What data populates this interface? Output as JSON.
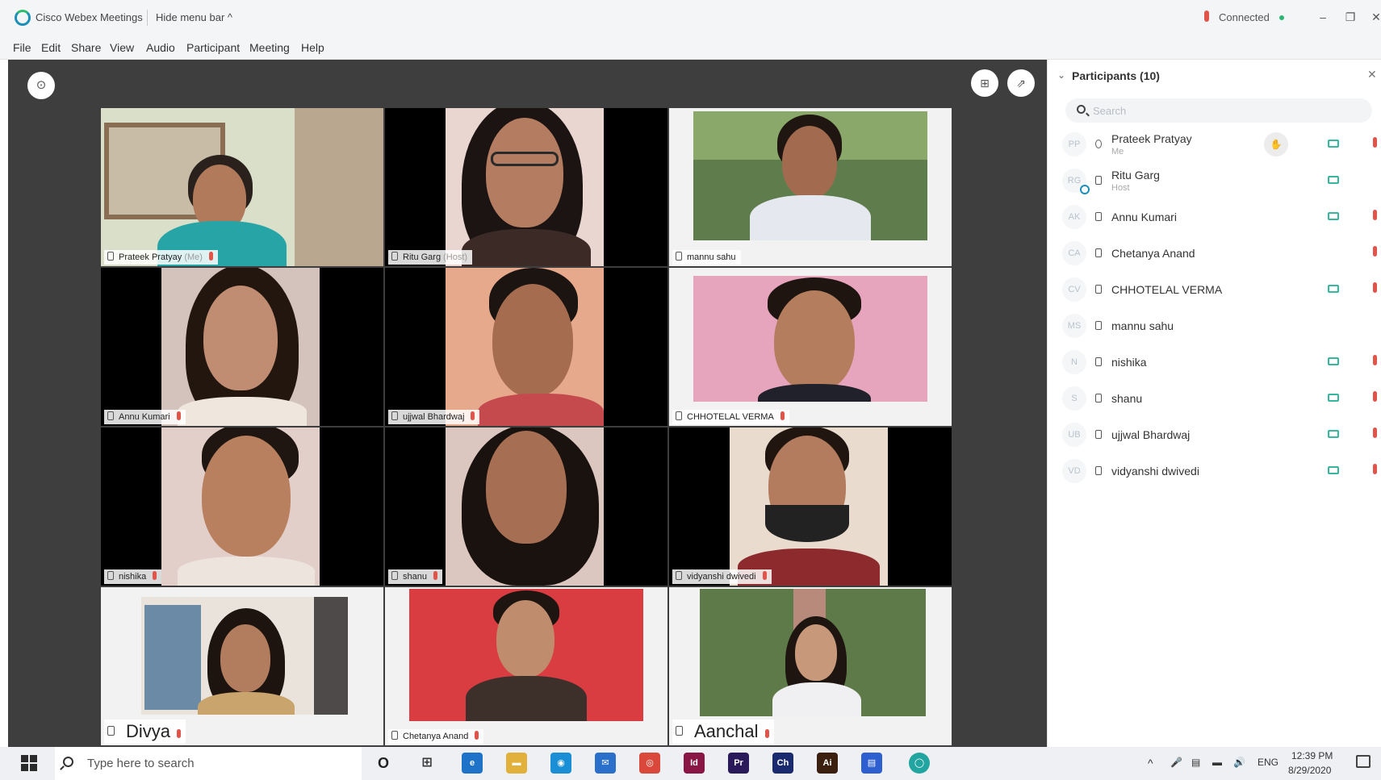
{
  "titlebar": {
    "app_title": "Cisco Webex Meetings",
    "hide_menu_label": "Hide menu bar ^",
    "status_label": "Connected",
    "status_color": "#2bb673",
    "minimize_glyph": "–",
    "maximize_glyph": "❐",
    "close_glyph": "✕"
  },
  "menu": {
    "items": [
      "File",
      "Edit",
      "Share",
      "View",
      "Audio",
      "Participant",
      "Meeting",
      "Help"
    ]
  },
  "video": {
    "info_glyph": "⊙",
    "layout_glyph": "⊞",
    "popout_glyph": "⇗",
    "tiles": [
      {
        "name": "Prateek Pratyay",
        "role": "(Me)"
      },
      {
        "name": "Ritu Garg",
        "role": "(Host)"
      },
      {
        "name": "mannu sahu",
        "role": ""
      },
      {
        "name": "Annu Kumari",
        "role": ""
      },
      {
        "name": "ujjwal Bhardwaj",
        "role": ""
      },
      {
        "name": "CHHOTELAL VERMA",
        "role": ""
      },
      {
        "name": "nishika",
        "role": ""
      },
      {
        "name": "shanu",
        "role": ""
      },
      {
        "name": "vidyanshi dwivedi",
        "role": ""
      },
      {
        "name": "Divya",
        "role": ""
      },
      {
        "name": "Chetanya Anand",
        "role": ""
      },
      {
        "name": "Aanchal",
        "role": ""
      }
    ]
  },
  "participants": {
    "title": "Participants (10)",
    "chevron_glyph": "⌄",
    "close_glyph": "✕",
    "search_placeholder": "Search",
    "raise_hand_glyph": "✋",
    "list": [
      {
        "initials": "PP",
        "name": "Prateek Pratyay",
        "sub": "Me"
      },
      {
        "initials": "RG",
        "name": "Ritu Garg",
        "sub": "Host"
      },
      {
        "initials": "AK",
        "name": "Annu Kumari",
        "sub": ""
      },
      {
        "initials": "CA",
        "name": "Chetanya Anand",
        "sub": ""
      },
      {
        "initials": "CV",
        "name": "CHHOTELAL VERMA",
        "sub": ""
      },
      {
        "initials": "MS",
        "name": "mannu sahu",
        "sub": ""
      },
      {
        "initials": "N",
        "name": "nishika",
        "sub": ""
      },
      {
        "initials": "S",
        "name": "shanu",
        "sub": ""
      },
      {
        "initials": "UB",
        "name": "ujjwal Bhardwaj",
        "sub": ""
      },
      {
        "initials": "VD",
        "name": "vidyanshi dwivedi",
        "sub": ""
      }
    ]
  },
  "taskbar": {
    "search_placeholder": "Type here to search",
    "cortana_glyph": "O",
    "taskview_glyph": "⊞",
    "apps": [
      {
        "label": "e",
        "color": "#1e73c8"
      },
      {
        "label": "▬",
        "color": "#e2b13c"
      },
      {
        "label": "◉",
        "color": "#1a8fd6"
      },
      {
        "label": "✉",
        "color": "#2a6fc9"
      },
      {
        "label": "◎",
        "color": "#d9483b"
      },
      {
        "label": "Id",
        "color": "#8a1646"
      },
      {
        "label": "Pr",
        "color": "#2b1a5a"
      },
      {
        "label": "Ch",
        "color": "#1a2a6e"
      },
      {
        "label": "Ai",
        "color": "#3b1f0f"
      },
      {
        "label": "▤",
        "color": "#2e5fd1"
      },
      {
        "label": "◯",
        "color": "#22a5a0"
      }
    ],
    "tray_chevron": "^",
    "language": "ENG",
    "time": "12:39 PM",
    "date": "8/29/2020"
  }
}
